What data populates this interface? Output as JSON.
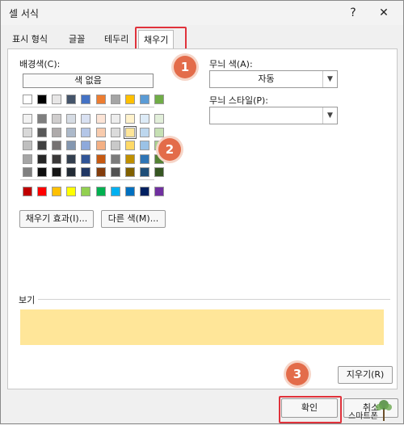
{
  "dialog": {
    "title": "셀 서식",
    "help": "?",
    "close": "✕"
  },
  "tabs": [
    {
      "label": "표시 형식"
    },
    {
      "label": "글꼴"
    },
    {
      "label": "테두리"
    },
    {
      "label": "채우기"
    }
  ],
  "fill": {
    "background_label": "배경색(C):",
    "no_color": "색 없음",
    "fill_effects": "채우기 효과(I)...",
    "more_colors": "다른 색(M)...",
    "selected_color": "#FFE699"
  },
  "pattern": {
    "color_label": "무늬 색(A):",
    "color_value": "자동",
    "style_label": "무늬 스타일(P):",
    "style_value": ""
  },
  "preview": {
    "label": "보기"
  },
  "buttons": {
    "clear": "지우기(R)",
    "ok": "확인",
    "cancel": "취소"
  },
  "badges": [
    "1",
    "2",
    "3"
  ],
  "watermark": {
    "text": "스마트폰"
  },
  "palette": {
    "theme_top": [
      "#FFFFFF",
      "#000000",
      "#E7E6E6",
      "#44546A",
      "#4472C4",
      "#ED7D31",
      "#A5A5A5",
      "#FFC000",
      "#5B9BD5",
      "#70AD47"
    ],
    "theme_shades": [
      [
        "#F2F2F2",
        "#7F7F7F",
        "#D0CECE",
        "#D6DCE4",
        "#D9E1F2",
        "#FCE4D6",
        "#EDEDED",
        "#FFF2CC",
        "#DDEBF7",
        "#E2EFDA"
      ],
      [
        "#D9D9D9",
        "#595959",
        "#AEAAAA",
        "#ACB9CA",
        "#B4C6E7",
        "#F8CBAD",
        "#DBDBDB",
        "#FFE699",
        "#BDD7EE",
        "#C6E0B4"
      ],
      [
        "#BFBFBF",
        "#404040",
        "#757171",
        "#8497B0",
        "#8EA9DB",
        "#F4B084",
        "#C9C9C9",
        "#FFD966",
        "#9BC2E6",
        "#A9D08E"
      ],
      [
        "#A6A6A6",
        "#262626",
        "#3A3838",
        "#333F4F",
        "#305496",
        "#C65911",
        "#7B7B7B",
        "#BF8F00",
        "#2F75B5",
        "#548235"
      ],
      [
        "#808080",
        "#0D0D0D",
        "#161616",
        "#222B35",
        "#203764",
        "#833C0C",
        "#525252",
        "#806000",
        "#1F4E78",
        "#375623"
      ]
    ],
    "standard": [
      "#C00000",
      "#FF0000",
      "#FFC000",
      "#FFFF00",
      "#92D050",
      "#00B050",
      "#00B0F0",
      "#0070C0",
      "#002060",
      "#7030A0"
    ]
  }
}
